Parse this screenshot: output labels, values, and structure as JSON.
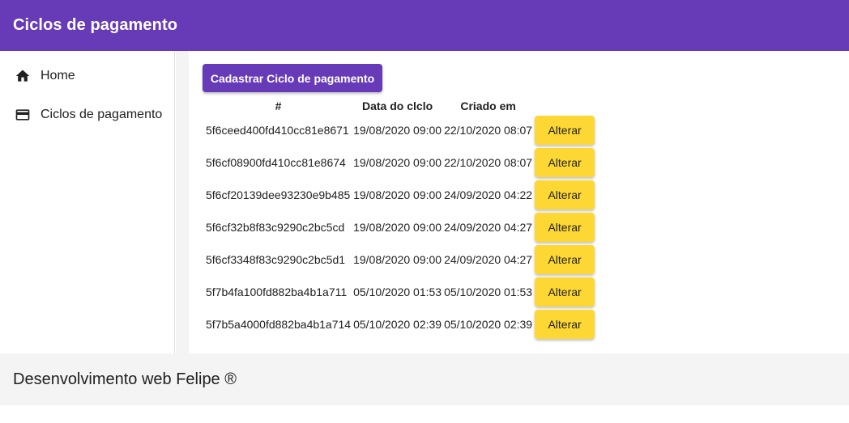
{
  "header": {
    "title": "Ciclos de pagamento"
  },
  "sidebar": {
    "items": [
      {
        "label": "Home",
        "icon": "home-icon"
      },
      {
        "label": "Ciclos de pagamento",
        "icon": "credit-card-icon"
      }
    ]
  },
  "main": {
    "create_button_label": "Cadastrar Ciclo de pagamento",
    "table": {
      "headers": [
        "#",
        "Data do clclo",
        "Criado em"
      ],
      "rows": [
        {
          "id": "5f6ceed400fd410cc81e8671",
          "date": "19/08/2020 09:00",
          "created": "22/10/2020 08:07",
          "action": "Alterar"
        },
        {
          "id": "5f6cf08900fd410cc81e8674",
          "date": "19/08/2020 09:00",
          "created": "22/10/2020 08:07",
          "action": "Alterar"
        },
        {
          "id": "5f6cf20139dee93230e9b485",
          "date": "19/08/2020 09:00",
          "created": "24/09/2020 04:22",
          "action": "Alterar"
        },
        {
          "id": "5f6cf32b8f83c9290c2bc5cd",
          "date": "19/08/2020 09:00",
          "created": "24/09/2020 04:27",
          "action": "Alterar"
        },
        {
          "id": "5f6cf3348f83c9290c2bc5d1",
          "date": "19/08/2020 09:00",
          "created": "24/09/2020 04:27",
          "action": "Alterar"
        },
        {
          "id": "5f7b4fa100fd882ba4b1a711",
          "date": "05/10/2020 01:53",
          "created": "05/10/2020 01:53",
          "action": "Alterar"
        },
        {
          "id": "5f7b5a4000fd882ba4b1a714",
          "date": "05/10/2020 02:39",
          "created": "05/10/2020 02:39",
          "action": "Alterar"
        }
      ]
    }
  },
  "footer": {
    "text": "Desenvolvimento web Felipe ®"
  },
  "colors": {
    "primary": "#673ab7",
    "accent": "#fdd835",
    "footer_background": "#f4f4f4"
  }
}
